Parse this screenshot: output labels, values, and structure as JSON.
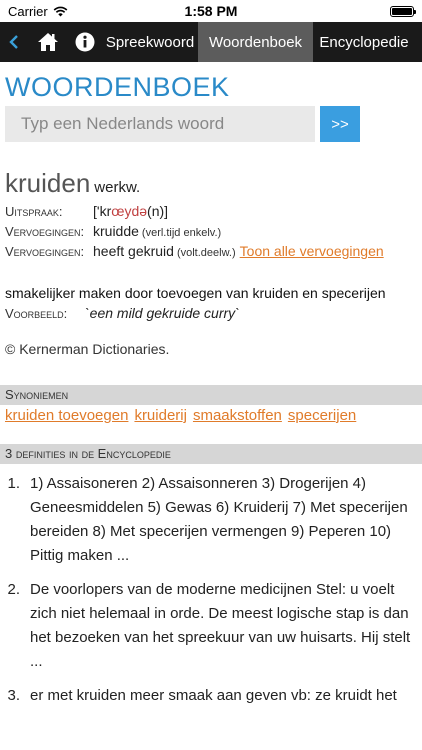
{
  "status": {
    "carrier": "Carrier",
    "time": "1:58 PM"
  },
  "nav": {
    "tabs": [
      "Spreekwoord",
      "Woordenboek",
      "Encyclopedie"
    ],
    "active_tab": "Woordenboek",
    "icons": [
      "back-chevron-icon",
      "home-icon",
      "info-icon"
    ]
  },
  "page": {
    "title": "WOORDENBOEK"
  },
  "search": {
    "placeholder": "Typ een Nederlands woord",
    "button_label": ">>"
  },
  "entry": {
    "headword": "kruiden",
    "pos": "werkw.",
    "uitspraak_label": "Uitspraak:",
    "uitspraak_open": "['kr",
    "uitspraak_red": "œydə",
    "uitspraak_close": "(n)]",
    "verv1_label": "Vervoegingen:",
    "verv1_value": "kruidde",
    "verv1_note": "(verl.tijd enkelv.)",
    "verv2_label": "Vervoegingen:",
    "verv2_value": "heeft gekruid",
    "verv2_note": "(volt.deelw.)",
    "verv2_link": "Toon alle vervoegingen",
    "definition": "smakelijker maken door toevoegen van kruiden en specerijen",
    "example_label": "Voorbeeld:",
    "example_text": "`een mild gekruide curry`",
    "copyright": "© Kernerman Dictionaries."
  },
  "synonyms": {
    "header": "Synoniemen",
    "items": [
      "kruiden toevoegen",
      "kruiderij",
      "smaakstoffen",
      "specerijen"
    ]
  },
  "encyclopedia": {
    "header": "3 definities in de Encyclopedie",
    "items": [
      {
        "num": "1.",
        "text": "1) Assaisoneren 2) Assaisonneren 3) Drogerijen 4) Geneesmiddelen 5) Gewas 6) Kruiderij 7) Met specerijen bereiden 8) Met specerijen vermengen 9) Peperen 10) Pittig maken ..."
      },
      {
        "num": "2.",
        "text": "De voorlopers van de moderne medicijnen Stel: u voelt zich niet helemaal in orde. De meest logische stap is dan het bezoeken van het spreekuur van uw huisarts. Hij stelt ..."
      },
      {
        "num": "3.",
        "text": "er met kruiden meer smaak aan geven vb: ze kruidt het"
      }
    ]
  },
  "colors": {
    "accent_blue": "#2a8ac8",
    "button_blue": "#3a9ee0",
    "link_orange": "#e07b2a",
    "navbar": "#1a1a1a",
    "active_tab": "#5c5c5c",
    "section_bar": "#d6d6d6"
  }
}
